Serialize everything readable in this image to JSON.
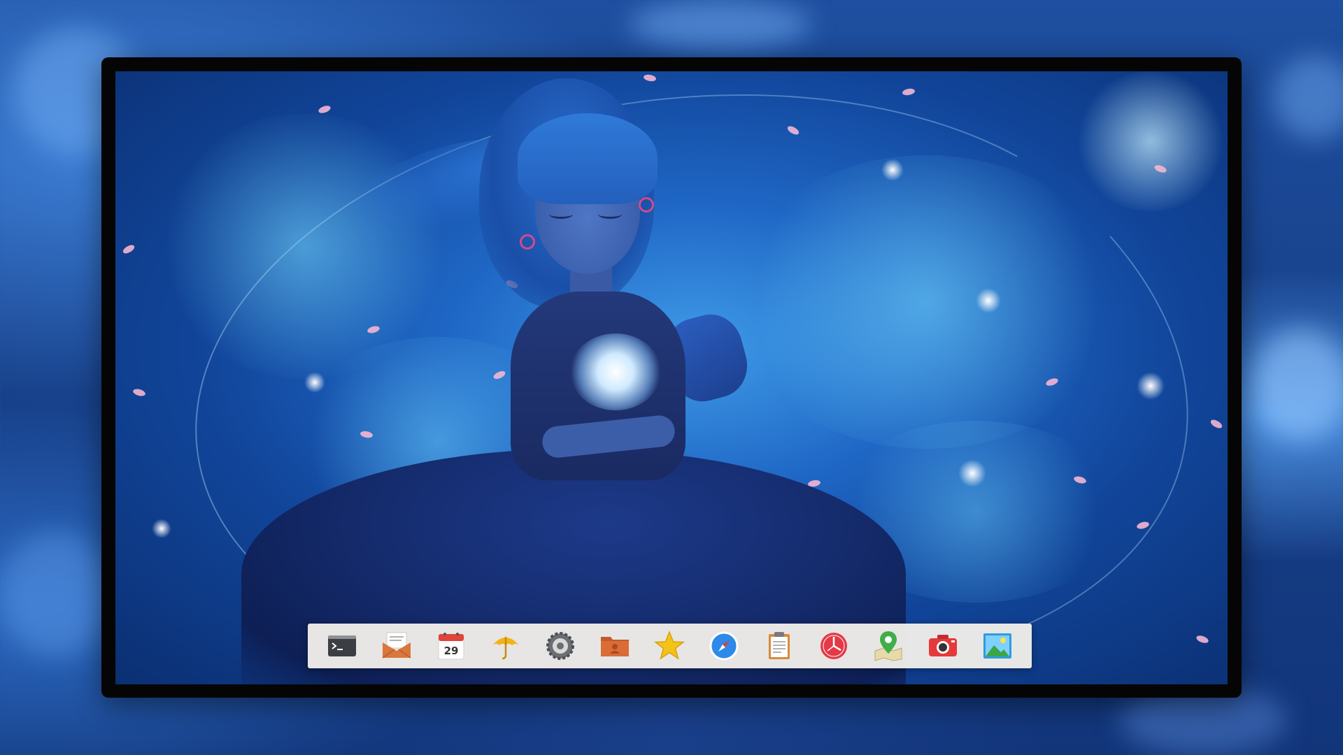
{
  "dock": {
    "items": [
      {
        "id": "terminal",
        "icon": "terminal-icon"
      },
      {
        "id": "mail",
        "icon": "mail-icon"
      },
      {
        "id": "calendar",
        "icon": "calendar-icon",
        "day": "29"
      },
      {
        "id": "weather",
        "icon": "umbrella-icon"
      },
      {
        "id": "settings",
        "icon": "gear-icon"
      },
      {
        "id": "contacts",
        "icon": "contacts-folder-icon"
      },
      {
        "id": "favorites",
        "icon": "star-icon"
      },
      {
        "id": "browser",
        "icon": "compass-icon"
      },
      {
        "id": "notes",
        "icon": "clipboard-icon"
      },
      {
        "id": "clock",
        "icon": "clock-icon"
      },
      {
        "id": "maps",
        "icon": "map-pin-icon"
      },
      {
        "id": "camera",
        "icon": "camera-icon"
      },
      {
        "id": "photos",
        "icon": "photos-icon"
      }
    ]
  },
  "colors": {
    "dock_background": "#eeece9",
    "accent_blue": "#1f67c5",
    "petal_pink": "#f4b6d2"
  }
}
